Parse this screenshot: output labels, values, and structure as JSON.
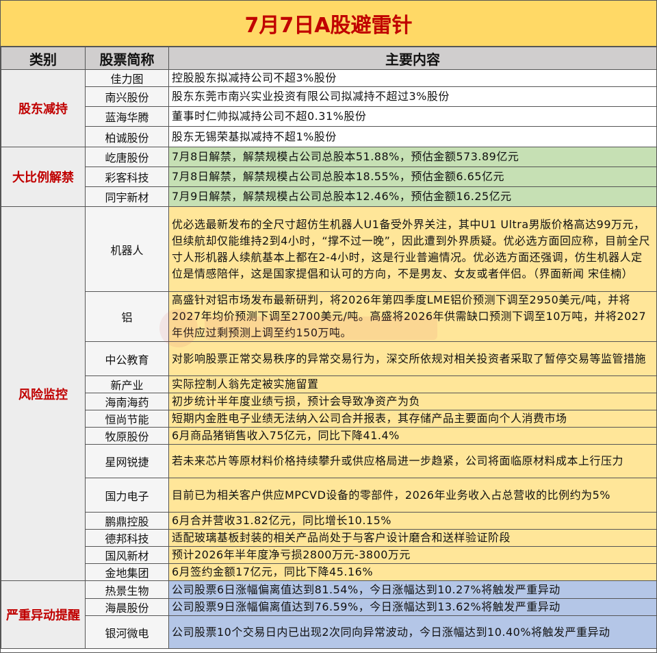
{
  "title": "7月7日A股避雷针",
  "headers": {
    "category": "类别",
    "stock": "股票简称",
    "content": "主要内容"
  },
  "groups": [
    {
      "category": "股东减持",
      "rows": [
        {
          "stock": "佳力图",
          "content": "控股股东拟减持公司不超3%股份"
        },
        {
          "stock": "南兴股份",
          "content": "股东东莞市南兴实业投资有限公司拟减持不超过3%股份"
        },
        {
          "stock": "蓝海华腾",
          "content": "董事时仁帅拟减持公司不超0.31%股份"
        },
        {
          "stock": "柏诚股份",
          "content": "股东无锡荣基拟减持不超1%股份"
        }
      ]
    },
    {
      "category": "大比例解禁",
      "rows": [
        {
          "stock": "屹唐股份",
          "content": "7月8日解禁，解禁规模占公司总股本51.88%，预估金额573.89亿元"
        },
        {
          "stock": "彩客科技",
          "content": "7月8日解禁，解禁规模占公司总股本18.55%，预估金额6.65亿元"
        },
        {
          "stock": "同宇新材",
          "content": "7月9日解禁，解禁规模占公司总股本12.46%，预估金额16.25亿元"
        }
      ]
    },
    {
      "category": "风险监控",
      "rows": [
        {
          "stock": "机器人",
          "content": "优必选最新发布的全尺寸超仿生机器人U1备受外界关注，其中U1 Ultra男版价格高达99万元，但续航却仅能维持2到4小时，“撑不过一晚”，因此遭到外界质疑。优必选方面回应称，目前全尺寸人形机器人续航基本上都在2-4小时，这是行业普遍情况。优必选方面还强调，仿生机器人定位是情感陪伴，这是国家提倡和认可的方向，不是男友、女友或者伴侣。（界面新闻 宋佳楠）"
        },
        {
          "stock": "铝",
          "content": "高盛针对铝市场发布最新研判，将2026年第四季度LME铝价预测下调至2950美元/吨，并将2027年均价预测下调至2700美元/吨。高盛将2026年供需缺口预测下调至10万吨，并将2027年供应过剩预测上调至约150万吨。"
        },
        {
          "stock": "中公教育",
          "content": "对影响股票正常交易秩序的异常交易行为，深交所依规对相关投资者采取了暂停交易等监管措施"
        },
        {
          "stock": "新产业",
          "content": "实际控制人翁先定被实施留置"
        },
        {
          "stock": "海南海药",
          "content": "初步统计半年度业绩亏损，预计会导致净资产为负"
        },
        {
          "stock": "恒尚节能",
          "content": "短期内金胜电子业绩无法纳入公司合并报表，其存储产品主要面向个人消费市场"
        },
        {
          "stock": "牧原股份",
          "content": "6月商品猪销售收入75亿元，同比下降41.4%"
        },
        {
          "stock": "星网锐捷",
          "content": "若未来芯片等原材料价格持续攀升或供应格局进一步趋紧，公司将面临原材料成本上行压力"
        },
        {
          "stock": "国力电子",
          "content": "目前已为相关客户供应MPCVD设备的零部件，2026年业务收入占总营收的比例约为5%"
        },
        {
          "stock": "鹏鼎控股",
          "content": "6月合并营收31.82亿元，同比增长10.15%"
        },
        {
          "stock": "德邦科技",
          "content": "适配玻璃基板封装的相关产品尚处于与客户设计磨合和送样验证阶段"
        },
        {
          "stock": "国风新材",
          "content": "预计2026年半年度净亏损2800万元-3800万元"
        },
        {
          "stock": "金地集团",
          "content": "6月签约金额17亿元，同比下降45.16%"
        }
      ]
    },
    {
      "category": "严重异动提醒",
      "rows": [
        {
          "stock": "热景生物",
          "content": "公司股票6日涨幅偏离值达到81.54%，今日涨幅达到10.27%将触发严重异动"
        },
        {
          "stock": "海晨股份",
          "content": "公司股票9日涨幅偏离值达到76.59%，今日涨幅达到13.62%将触发严重异动"
        },
        {
          "stock": "银河微电",
          "content": "公司股票10个交易日内已出现2次同向异常波动，今日涨幅达到10.40%将触发严重异动"
        }
      ]
    }
  ]
}
